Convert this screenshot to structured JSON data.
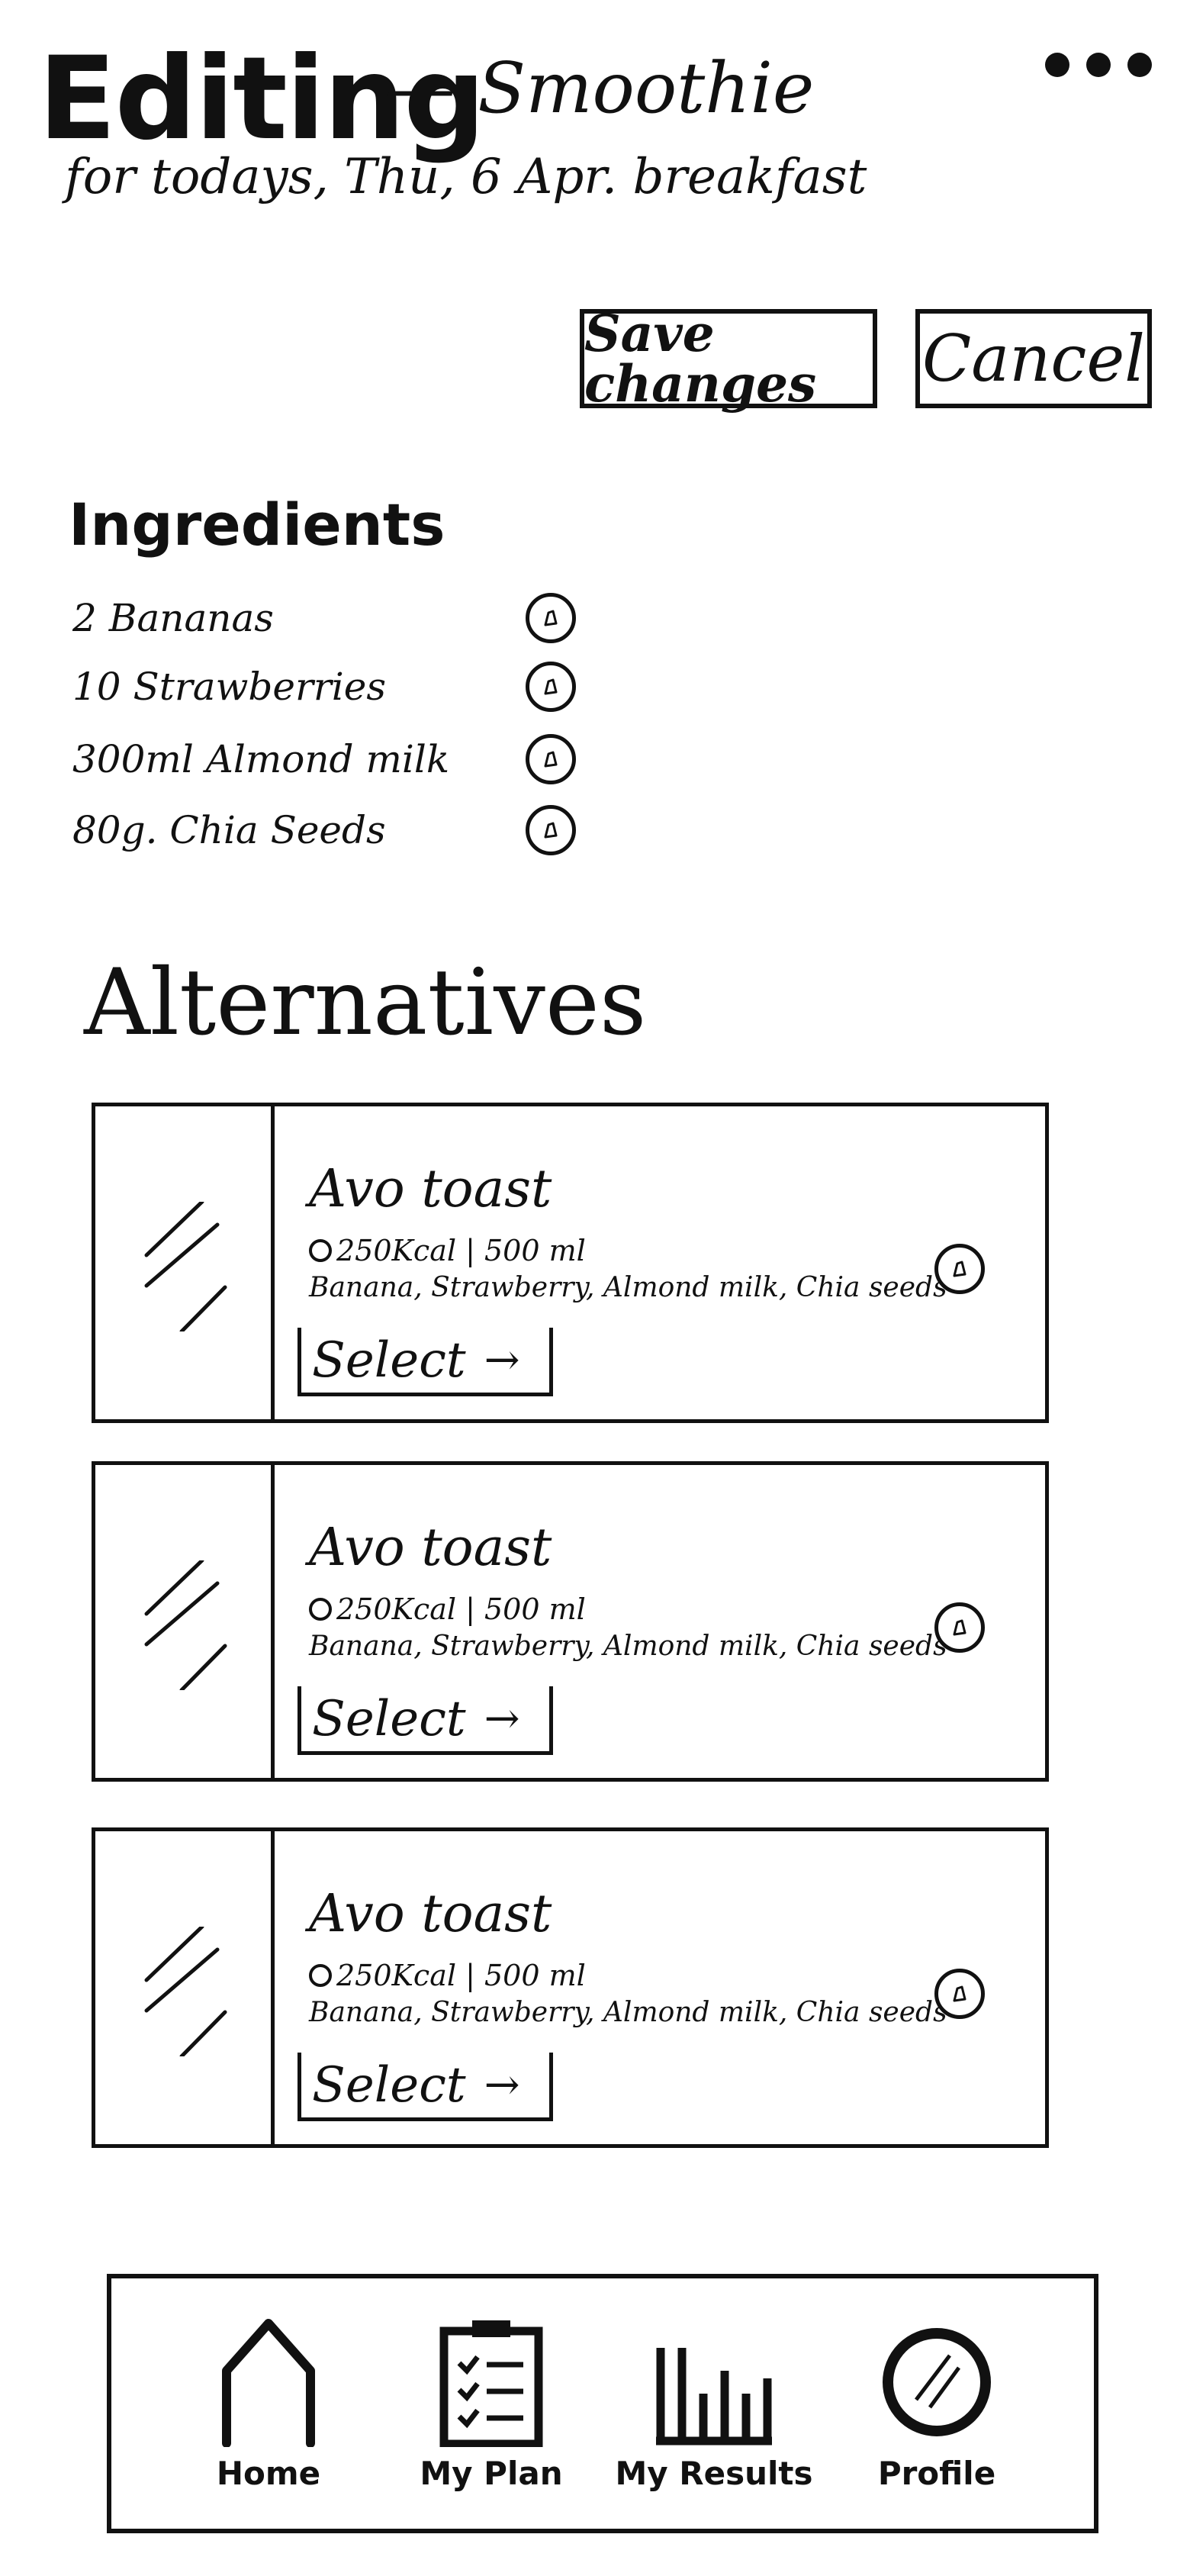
{
  "header": {
    "title": "Editing",
    "subtitle": "— Smoothie",
    "meal_line": "for todays, Thu, 6 Apr. breakfast",
    "more_icon": "more-dots-icon"
  },
  "actions": {
    "save_label": "Save changes",
    "cancel_label": "Cancel"
  },
  "ingredients": {
    "heading": "Ingredients",
    "items": [
      {
        "label": "2 Bananas",
        "icon": "edit-icon"
      },
      {
        "label": "10 Strawberries",
        "icon": "edit-icon"
      },
      {
        "label": "300ml Almond milk",
        "icon": "edit-icon"
      },
      {
        "label": "80g. Chia Seeds",
        "icon": "edit-icon"
      }
    ]
  },
  "alternatives": {
    "heading": "Alternatives",
    "items": [
      {
        "title": "Avo toast",
        "meta": "250Kcal | 500 ml",
        "ingredients": "Banana, Strawberry, Almond milk, Chia seeds",
        "select_label": "Select",
        "select_arrow": "→"
      },
      {
        "title": "Avo toast",
        "meta": "250Kcal | 500 ml",
        "ingredients": "Banana, Strawberry, Almond milk, Chia seeds",
        "select_label": "Select",
        "select_arrow": "→"
      },
      {
        "title": "Avo toast",
        "meta": "250Kcal | 500 ml",
        "ingredients": "Banana, Strawberry, Almond milk, Chia seeds",
        "select_label": "Select",
        "select_arrow": "→"
      }
    ]
  },
  "nav": {
    "items": [
      {
        "label": "Home",
        "icon": "home-icon"
      },
      {
        "label": "My Plan",
        "icon": "clipboard-icon"
      },
      {
        "label": "My Results",
        "icon": "bar-chart-icon"
      },
      {
        "label": "Profile",
        "icon": "profile-icon"
      }
    ]
  },
  "colors": {
    "ink": "#111111",
    "background": "#ffffff"
  }
}
